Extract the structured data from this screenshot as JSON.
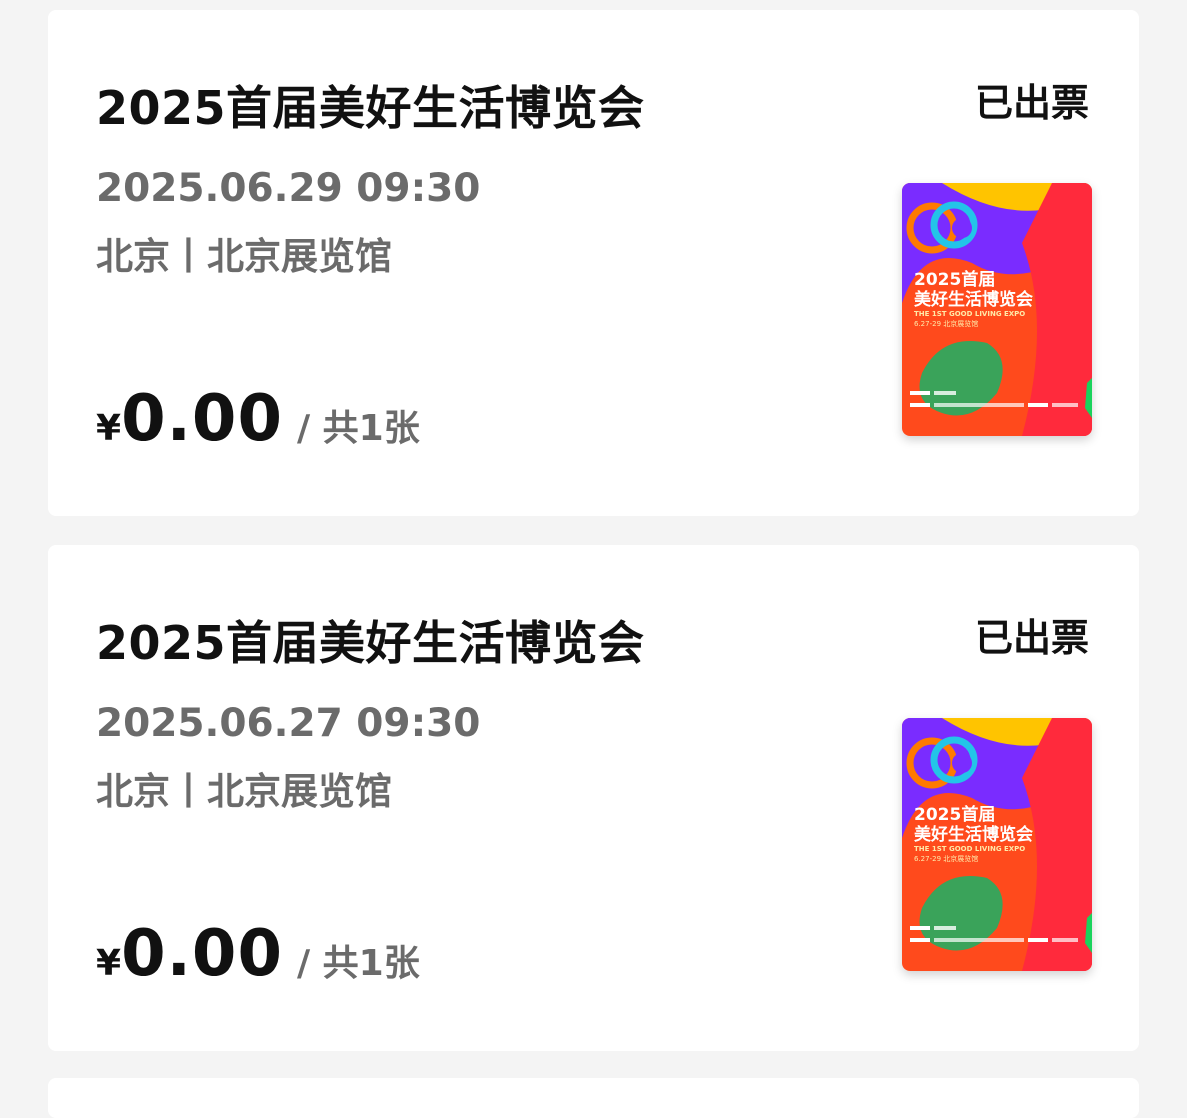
{
  "orders": [
    {
      "title": "2025首届美好生活博览会",
      "status": "已出票",
      "datetime": "2025.06.29 09:30",
      "venue": "北京丨北京展览馆",
      "currency": "¥",
      "amount": "0.00",
      "quantity": "/ 共1张",
      "poster": {
        "line1": "2025首届",
        "line2": "美好生活博览会",
        "line3": "THE 1ST GOOD LIVING EXPO",
        "line4": "6.27-29 北京展览馆"
      }
    },
    {
      "title": "2025首届美好生活博览会",
      "status": "已出票",
      "datetime": "2025.06.27 09:30",
      "venue": "北京丨北京展览馆",
      "currency": "¥",
      "amount": "0.00",
      "quantity": "/ 共1张",
      "poster": {
        "line1": "2025首届",
        "line2": "美好生活博览会",
        "line3": "THE 1ST GOOD LIVING EXPO",
        "line4": "6.27-29 北京展览馆"
      }
    }
  ],
  "colors": {
    "background": "#f4f4f4",
    "card": "#ffffff",
    "primary_text": "#111111",
    "secondary_text": "#6b6b6b",
    "poster_red": "#ff3b2f",
    "poster_purple": "#7a2cff",
    "poster_yellow": "#ffc400",
    "poster_green": "#3aa35a"
  }
}
